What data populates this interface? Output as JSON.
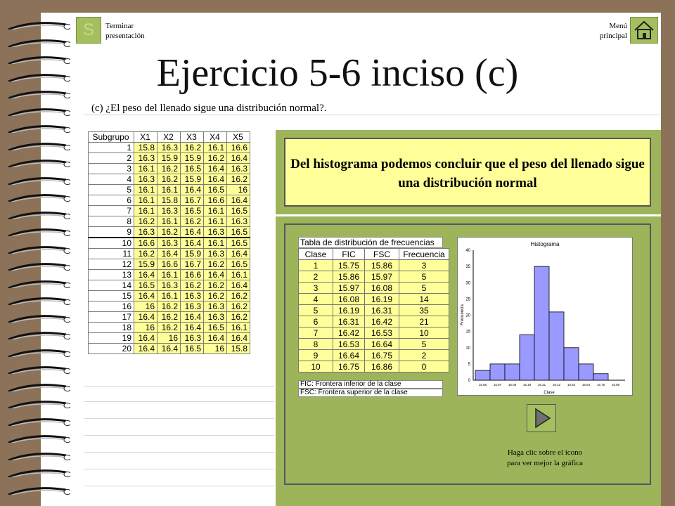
{
  "header": {
    "stop_icon_letter": "S",
    "end_label_1": "Terminar",
    "end_label_2": "presentación",
    "menu_label_1": "Menú",
    "menu_label_2": "principal"
  },
  "title": "Ejercicio 5-6 inciso (c)",
  "question": "(c)  ¿El peso del llenado sigue una distribución normal?.",
  "data_table": {
    "headers": [
      "Subgrupo",
      "X1",
      "X2",
      "X3",
      "X4",
      "X5"
    ],
    "rows": [
      [
        "1",
        "15.8",
        "16.3",
        "16.2",
        "16.1",
        "16.6"
      ],
      [
        "2",
        "16.3",
        "15.9",
        "15.9",
        "16.2",
        "16.4"
      ],
      [
        "3",
        "16.1",
        "16.2",
        "16.5",
        "16.4",
        "16.3"
      ],
      [
        "4",
        "16.3",
        "16.2",
        "15.9",
        "16.4",
        "16.2"
      ],
      [
        "5",
        "16.1",
        "16.1",
        "16.4",
        "16.5",
        "16"
      ],
      [
        "6",
        "16.1",
        "15.8",
        "16.7",
        "16.6",
        "16.4"
      ],
      [
        "7",
        "16.1",
        "16.3",
        "16.5",
        "16.1",
        "16.5"
      ],
      [
        "8",
        "16.2",
        "16.1",
        "16.2",
        "16.1",
        "16.3"
      ],
      [
        "9",
        "16.3",
        "16.2",
        "16.4",
        "16.3",
        "16.5"
      ],
      [
        "10",
        "16.6",
        "16.3",
        "16.4",
        "16.1",
        "16.5"
      ],
      [
        "11",
        "16.2",
        "16.4",
        "15.9",
        "16.3",
        "16.4"
      ],
      [
        "12",
        "15.9",
        "16.6",
        "16.7",
        "16.2",
        "16.5"
      ],
      [
        "13",
        "16.4",
        "16.1",
        "16.6",
        "16.4",
        "16.1"
      ],
      [
        "14",
        "16.5",
        "16.3",
        "16.2",
        "16.2",
        "16.4"
      ],
      [
        "15",
        "16.4",
        "16.1",
        "16.3",
        "16.2",
        "16.2"
      ],
      [
        "16",
        "16",
        "16.2",
        "16.3",
        "16.3",
        "16.2"
      ],
      [
        "17",
        "16.4",
        "16.2",
        "16.4",
        "16.3",
        "16.2"
      ],
      [
        "18",
        "16",
        "16.2",
        "16.4",
        "16.5",
        "16.1"
      ],
      [
        "19",
        "16.4",
        "16",
        "16.3",
        "16.4",
        "16.4"
      ],
      [
        "20",
        "16.4",
        "16.4",
        "16.5",
        "16",
        "15.8"
      ]
    ]
  },
  "conclusion": "Del histograma podemos concluir que el peso del llenado sigue una distribución normal",
  "freq_table": {
    "title": "Tabla de distribución de frecuencias",
    "headers": [
      "Clase",
      "FIC",
      "FSC",
      "Frecuencia"
    ],
    "rows": [
      [
        "1",
        "15.75",
        "15.86",
        "3"
      ],
      [
        "2",
        "15.86",
        "15.97",
        "5"
      ],
      [
        "3",
        "15.97",
        "16.08",
        "5"
      ],
      [
        "4",
        "16.08",
        "16.19",
        "14"
      ],
      [
        "5",
        "16.19",
        "16.31",
        "35"
      ],
      [
        "6",
        "16.31",
        "16.42",
        "21"
      ],
      [
        "7",
        "16.42",
        "16.53",
        "10"
      ],
      [
        "8",
        "16.53",
        "16.64",
        "5"
      ],
      [
        "9",
        "16.64",
        "16.75",
        "2"
      ],
      [
        "10",
        "16.75",
        "16.86",
        "0"
      ]
    ],
    "note_fic": "FIC: Frontera inferior de la clase",
    "note_fsc": "FSC: Frontera superior de la clase"
  },
  "chart_data": {
    "type": "bar",
    "title": "Histograma",
    "xlabel": "Clase",
    "ylabel": "Frecuencia",
    "categories": [
      "15.86",
      "15.97",
      "16.08",
      "16.19",
      "16.31",
      "16.42",
      "16.53",
      "16.64",
      "16.75",
      "16.86"
    ],
    "values": [
      3,
      5,
      5,
      14,
      35,
      21,
      10,
      5,
      2,
      0
    ],
    "ylim": [
      0,
      40
    ],
    "yticks": [
      0,
      5,
      10,
      15,
      20,
      25,
      30,
      35,
      40
    ],
    "bar_color": "#9999ff",
    "grid": false
  },
  "hint": {
    "line1": "Haga clic sobre el icono",
    "line2": "para ver mejor la gráfica"
  },
  "colors": {
    "background": "#8b7258",
    "panel_green": "#9db45a",
    "cell_yellow": "#ffff99"
  }
}
